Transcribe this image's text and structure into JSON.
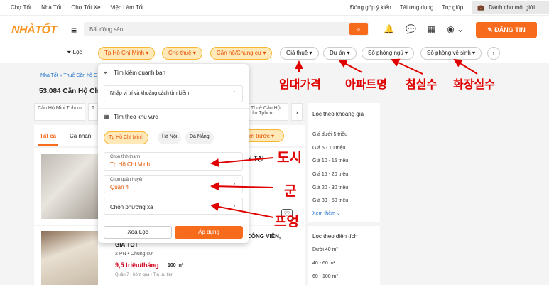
{
  "topbar": {
    "links": [
      "Chợ Tốt",
      "Nhà Tốt",
      "Chợ Tốt Xe",
      "Việc Làm Tốt"
    ],
    "right": [
      "Đóng góp ý kiến",
      "Tải ứng dụng",
      "Trợ giúp"
    ],
    "seller": "Dành cho môi giới"
  },
  "header": {
    "logo": "NHÀTỐT",
    "search_placeholder": "Bất động sản",
    "post_label": "ĐĂNG TIN"
  },
  "filters": {
    "loc": "Lọc",
    "chips": [
      "Tp Hồ Chí Minh",
      "Cho thuê",
      "Căn hộ/Chung cư",
      "Giá thuê",
      "Dự án",
      "Số phòng ngủ",
      "Số phòng vệ sinh"
    ]
  },
  "breadcrumb": "Nhà Tốt » Thuê Căn hộ C",
  "result_count": "53.084 Căn Hộ Chu",
  "categories": [
    "Căn Hộ Mini Tphcm",
    "T",
    "Thuê Căn Hộ dio Tphcm"
  ],
  "tabs": [
    "Tất cả",
    "Cá nhân"
  ],
  "sort": "ới trước",
  "listing1": {
    "title": "N TẠI"
  },
  "listing2": {
    "title": "CÔNG VIÊN,",
    "title2": "GIÁ TỐT",
    "meta": "2 PN • Chung cư",
    "price": "9,5 triệu/tháng",
    "area": "100 m²",
    "sub": "Quận 7 • hôm qua • Tin ưu tiên"
  },
  "sidebar": {
    "price_title": "Lọc theo khoảng giá",
    "prices": [
      "Giá dưới 5 triệu",
      "Giá 5 - 10 triệu",
      "Giá 10 - 15 triệu",
      "Giá 15 - 20 triệu",
      "Giá 20 - 30 triệu",
      "Giá 30 - 50 triệu"
    ],
    "more": "Xem thêm",
    "area_title": "Lọc theo diện tích",
    "areas": [
      "Dưới 40 m²",
      "40 - 60 m²",
      "60 - 100 m²"
    ]
  },
  "panel": {
    "nearby_title": "Tìm kiếm quanh bạn",
    "nearby_input": "Nhập vị trí và khoảng cách tìm kiếm",
    "area_title": "Tìm theo khu vực",
    "cities": [
      "Tp Hồ Chí Minh",
      "Hà Nội",
      "Đà Nẵng"
    ],
    "province_label": "Chọn tỉnh thành",
    "province_value": "Tp Hồ Chí Minh",
    "district_label": "Chọn quận huyện",
    "district_value": "Quận 4",
    "ward_label": "Chọn phường xã",
    "clear": "Xoá Lọc",
    "apply": "Áp dụng"
  },
  "annotations": {
    "price": "임대가격",
    "project": "아파트명",
    "bedrooms": "침실수",
    "bathrooms": "화장실수",
    "city": "도시",
    "district": "군",
    "ward": "프엉"
  }
}
